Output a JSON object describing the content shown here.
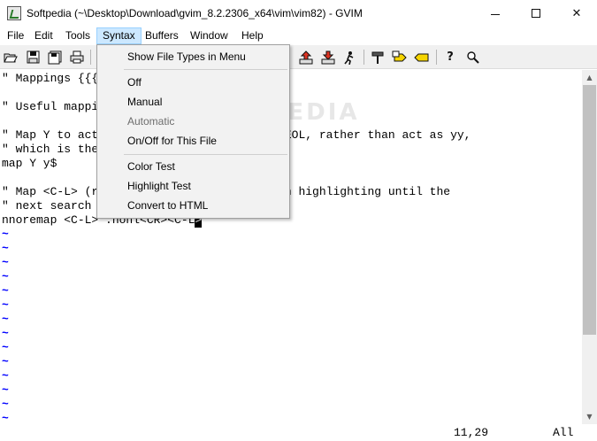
{
  "window": {
    "title": "Softpedia (~\\Desktop\\Download\\gvim_8.2.2306_x64\\vim\\vim82) - GVIM",
    "icon": "gvim-app-icon",
    "controls": {
      "minimize": "minimize",
      "maximize": "maximize",
      "close": "✕"
    }
  },
  "menubar": {
    "items": [
      "File",
      "Edit",
      "Tools",
      "Syntax",
      "Buffers",
      "Window",
      "Help"
    ],
    "active": "Syntax"
  },
  "toolbar": {
    "icons": [
      "open-icon",
      "save-icon",
      "save-all-icon",
      "print-icon",
      "load-session-icon",
      "save-session-icon",
      "run-script-icon",
      "make-icon",
      "run-ctags-icon",
      "jump-to-tag-icon",
      "help-icon",
      "find-help-icon"
    ]
  },
  "syntax_menu": {
    "items": [
      {
        "label": "Show File Types in Menu",
        "enabled": true
      },
      {
        "label": "Off",
        "enabled": true
      },
      {
        "label": "Manual",
        "enabled": true
      },
      {
        "label": "Automatic",
        "enabled": false
      },
      {
        "label": "On/Off for This File",
        "enabled": true
      },
      {
        "label": "Color Test",
        "enabled": true
      },
      {
        "label": "Highlight Test",
        "enabled": true
      },
      {
        "label": "Convert to HTML",
        "enabled": true
      }
    ]
  },
  "editor": {
    "lines": [
      "\" Mappings {{{",
      "",
      "\" Useful mappi",
      "",
      "\" Map Y to act                     until EOL, rather than act as yy,",
      "\" which is the",
      "map Y y$",
      "",
      "\" Map <C-L> (r                  off search highlighting until the",
      "\" next search",
      "nnoremap <C-L> :nohl<CR><C-L"
    ],
    "cursor_char": ">",
    "tilde": "~",
    "tilde_count": 14
  },
  "watermark": "SOFTPEDIA",
  "status": {
    "position": "11,29",
    "scroll": "All"
  },
  "colors": {
    "tilde": "#0000ff",
    "menu_active": "#cce8ff",
    "menu_bg": "#f2f2f2",
    "toolbar_bg": "#f0f0f0"
  }
}
